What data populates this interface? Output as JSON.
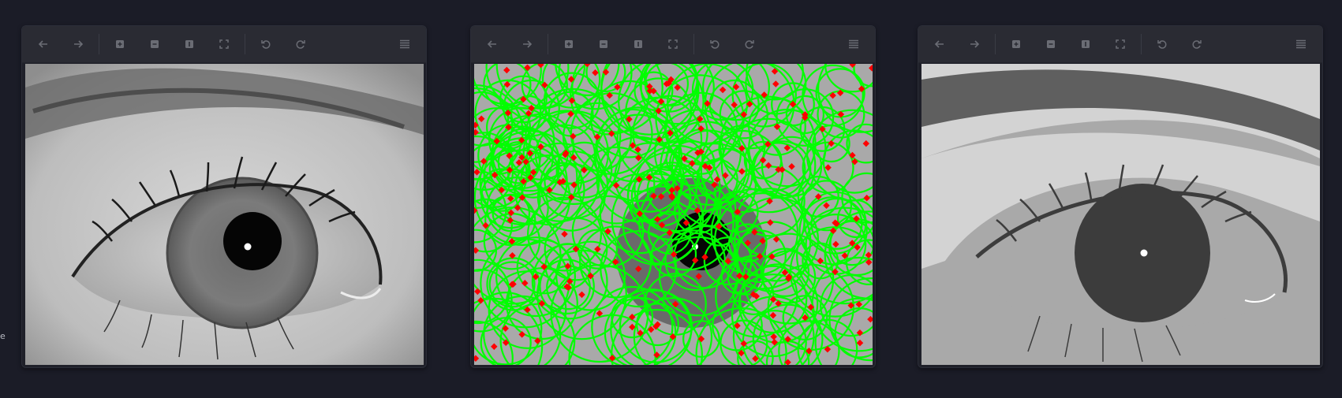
{
  "edge_text": "e",
  "toolbar_icons": [
    "back-arrow-icon",
    "forward-arrow-icon",
    "zoom-in-icon",
    "zoom-out-icon",
    "actual-size-icon",
    "fit-screen-icon",
    "rotate-left-icon",
    "rotate-right-icon",
    "menu-icon"
  ],
  "panels": [
    {
      "id": "original",
      "image": "grayscale-eye-photo"
    },
    {
      "id": "detection",
      "image": "eye-photo-with-circle-detections"
    },
    {
      "id": "segmented",
      "image": "posterized-eye-segmentation"
    }
  ],
  "colors": {
    "page_background": "#1b1c27",
    "toolbar": "#2a2b33",
    "icon": "#6a6c74",
    "detection_circle": "#00ff00",
    "detection_center": "#ff0000"
  }
}
